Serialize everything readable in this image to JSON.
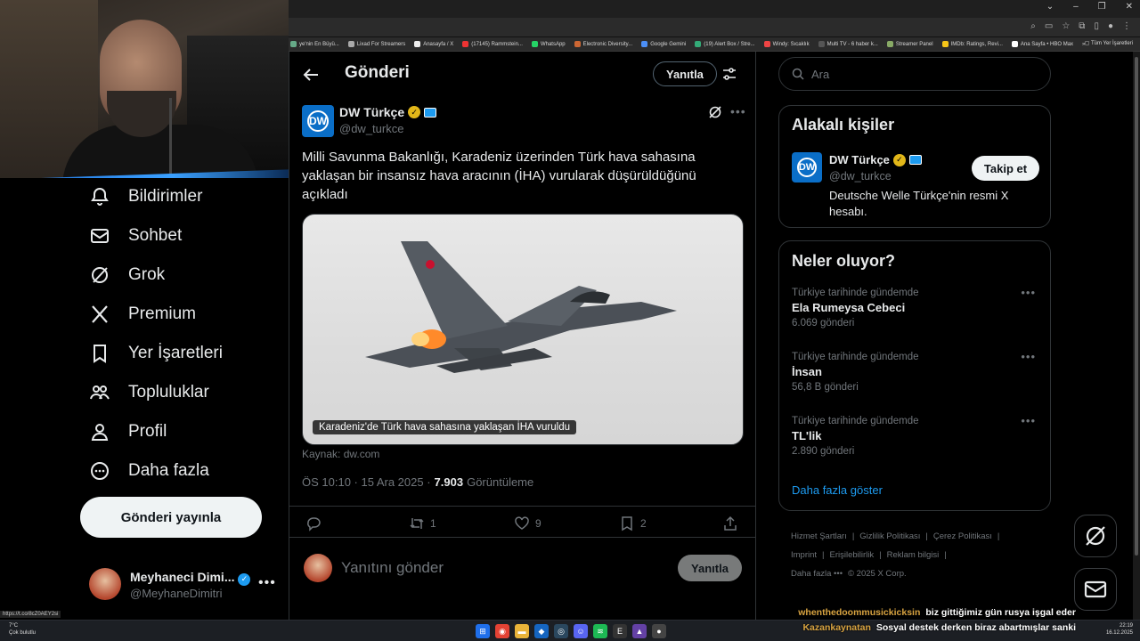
{
  "browser": {
    "bookmarks": [
      "ye'nin En Büyü...",
      "Lixad For Streamers",
      "Anasayfa / X",
      "(17145) Rammstein...",
      "WhatsApp",
      "Electronic Diversity...",
      "Google Gemini",
      "(19) Alert Box / Stre...",
      "Windy: Sıcaklık",
      "Multi TV - 6 haber k...",
      "Streamer Panel",
      "IMDb: Ratings, Revi...",
      "Ana Sayfa • HBO Max"
    ],
    "bookmarks_more": "»",
    "all_bookmarks": "Tüm Yer İşaretleri",
    "status_url": "https://t.co/8cZ0AEY2si"
  },
  "nav": {
    "partial_item": "Bildirimler",
    "items": [
      "Sohbet",
      "Grok",
      "Premium",
      "Yer İşaretleri",
      "Topluluklar",
      "Profil",
      "Daha fazla"
    ],
    "post_button": "Gönderi yayınla",
    "account_name": "Meyhaneci Dimi...",
    "account_handle": "@MeyhaneDimitri",
    "account_more": "•••"
  },
  "main": {
    "title": "Gönderi",
    "reply_top": "Yanıtla",
    "author": {
      "avatar_text": "DW",
      "name": "DW Türkçe",
      "handle": "@dw_turkce"
    },
    "more": "•••",
    "text": "Milli Savunma Bakanlığı, Karadeniz üzerinden Türk hava sahasına yaklaşan bir insansız hava aracının (İHA) vurularak düşürüldüğünü açıkladı",
    "media_caption": "Karadeniz'de Türk hava sahasına yaklaşan İHA vuruldu",
    "source": "Kaynak: dw.com",
    "time": "ÖS 10:10 · 15 Ara 2025 ·",
    "views": "7.903",
    "views_label": "Görüntüleme",
    "actions": {
      "reply_count": "",
      "retweet_count": "1",
      "like_count": "9",
      "bookmark_count": "2"
    },
    "reply_placeholder": "Yanıtını gönder",
    "reply_button": "Yanıtla"
  },
  "right": {
    "search_placeholder": "Ara",
    "people_title": "Alakalı kişiler",
    "person": {
      "avatar_text": "DW",
      "name": "DW Türkçe",
      "handle": "@dw_turkce",
      "bio": "Deutsche Welle Türkçe'nin resmi X hesabı.",
      "follow": "Takip et"
    },
    "trends_title": "Neler oluyor?",
    "trends": [
      {
        "context": "Türkiye tarihinde gündemde",
        "title": "Ela Rumeysa Cebeci",
        "count": "6.069 gönderi"
      },
      {
        "context": "Türkiye tarihinde gündemde",
        "title": "İnsan",
        "count": "56,8 B gönderi"
      },
      {
        "context": "Türkiye tarihinde gündemde",
        "title": "TL'lik",
        "count": "2.890 gönderi"
      }
    ],
    "show_more": "Daha fazla göster",
    "footer": [
      "Hizmet Şartları",
      "|",
      "Gizlilik Politikası",
      "|",
      "Çerez Politikası",
      "|",
      "Imprint",
      "|",
      "Erişilebilirlik",
      "|",
      "Reklam bilgisi",
      "|",
      "Daha fazla •••",
      "© 2025 X Corp."
    ]
  },
  "chat": [
    {
      "user": "whenthedoommusickicksin",
      "message": "biz gittiğimiz gün rusya işgal eder"
    },
    {
      "user": "Kazankaynatan",
      "message": "Sosyal destek derken biraz abartmışlar sanki"
    }
  ],
  "taskbar": {
    "weather_temp": "7°C",
    "weather_desc": "Çok bulutlu",
    "clock_time": "22:19",
    "clock_date": "16.12.2025"
  },
  "colors": {
    "accent": "#1d9bf0",
    "background": "#000000",
    "border": "#2f3336",
    "muted": "#71767b",
    "verified_gold": "#e2b719"
  }
}
